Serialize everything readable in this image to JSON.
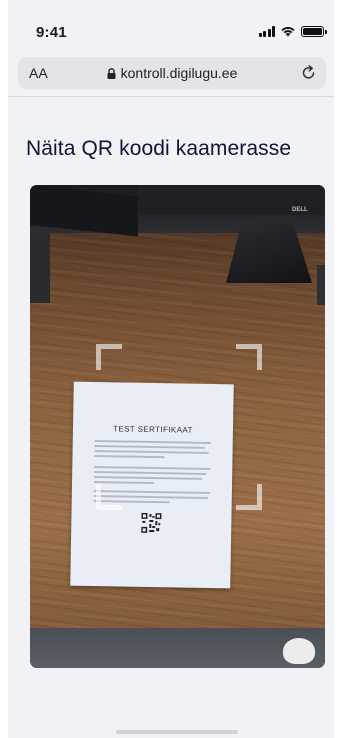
{
  "status_bar": {
    "time": "9:41"
  },
  "browser": {
    "text_size_label": "AA",
    "url": "kontroll.digilugu.ee"
  },
  "page": {
    "title": "Näita QR koodi kaamerasse"
  },
  "camera": {
    "document_title": "TEST SERTIFIKAAT",
    "monitor_brand": "DELL"
  },
  "icons": [
    "signal-icon",
    "wifi-icon",
    "battery-icon",
    "lock-icon",
    "reload-icon",
    "qr-code-icon"
  ],
  "colors": {
    "page_background": "#f1f2f6",
    "title_color": "#0d1633",
    "address_bar": "#e3e3e8"
  }
}
